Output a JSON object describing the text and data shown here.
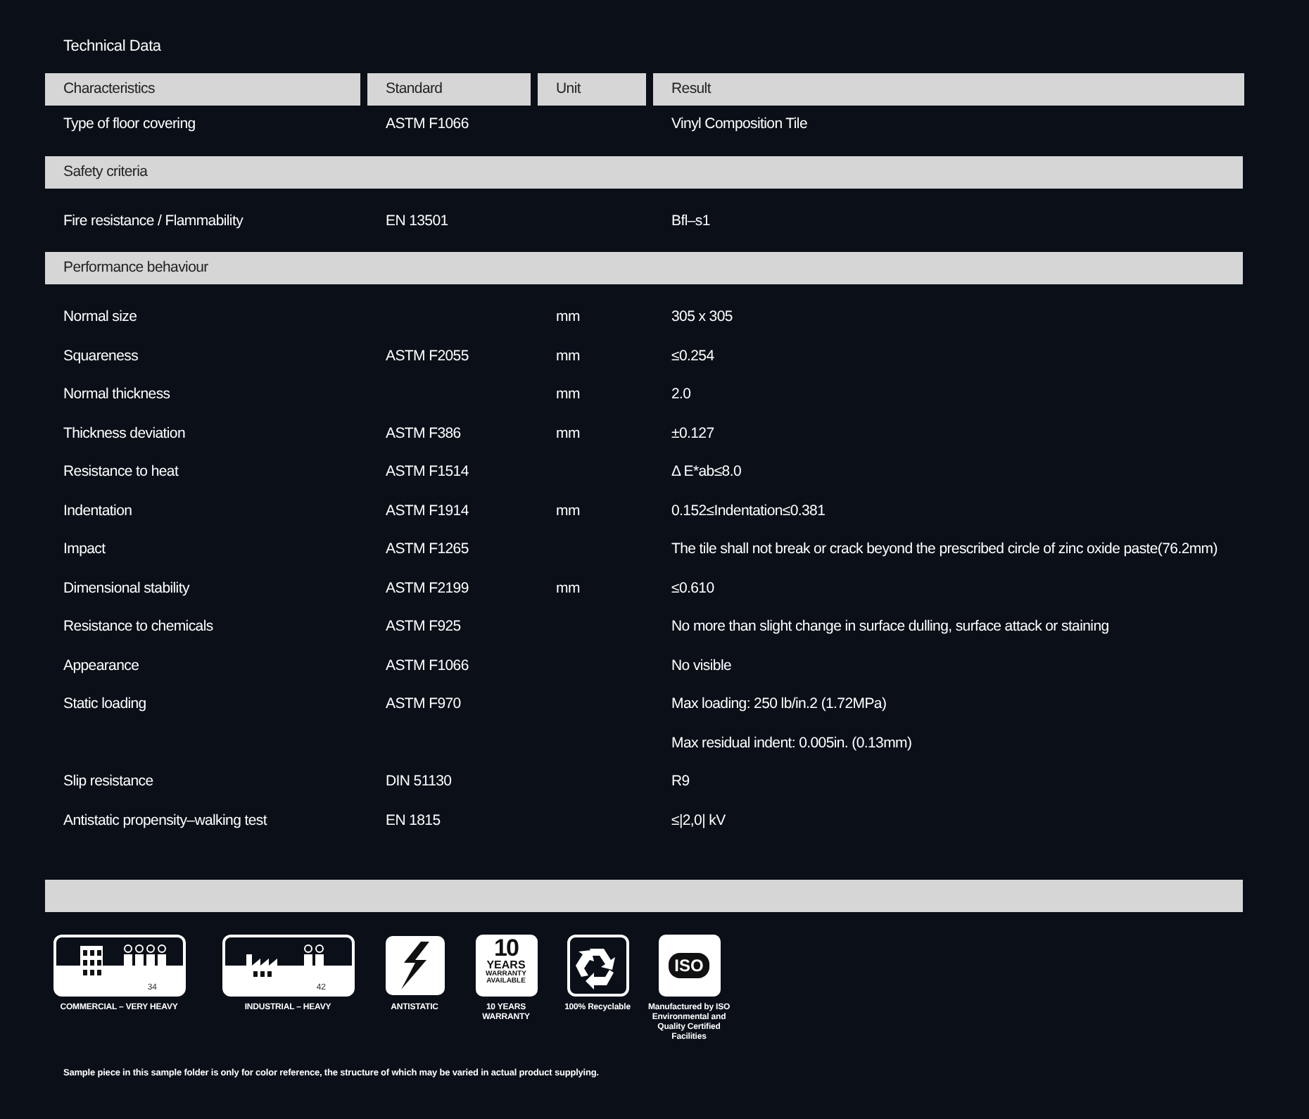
{
  "title": "Technical Data",
  "columns": [
    "Characteristics",
    "Standard",
    "Unit",
    "Result"
  ],
  "rows": [
    {
      "kind": "data",
      "cells": [
        "Type of floor covering",
        "ASTM F1066",
        "",
        "Vinyl Composition Tile"
      ]
    },
    {
      "kind": "section",
      "label": "Safety criteria"
    },
    {
      "kind": "data",
      "cells": [
        "Fire resistance / Flammability",
        "EN 13501",
        "",
        "Bfl–s1"
      ]
    },
    {
      "kind": "section",
      "label": "Performance behaviour"
    },
    {
      "kind": "data",
      "cells": [
        "Normal size",
        "",
        "mm",
        "305 x 305"
      ]
    },
    {
      "kind": "data",
      "cells": [
        "Squareness",
        "ASTM F2055",
        "mm",
        "≤0.254"
      ]
    },
    {
      "kind": "data",
      "cells": [
        "Normal thickness",
        "",
        "mm",
        "2.0"
      ]
    },
    {
      "kind": "data",
      "cells": [
        "Thickness deviation",
        "ASTM F386",
        "mm",
        "±0.127"
      ]
    },
    {
      "kind": "data",
      "cells": [
        "Resistance to heat",
        "ASTM F1514",
        "",
        "Δ E*ab≤8.0"
      ]
    },
    {
      "kind": "data",
      "cells": [
        "Indentation",
        "ASTM F1914",
        "mm",
        "0.152≤Indentation≤0.381"
      ]
    },
    {
      "kind": "data",
      "cells": [
        "Impact",
        "ASTM F1265",
        "",
        "The tile shall not break or crack beyond the prescribed circle of zinc oxide paste(76.2mm)"
      ]
    },
    {
      "kind": "data",
      "cells": [
        "Dimensional stability",
        "ASTM F2199",
        "mm",
        "≤0.610"
      ]
    },
    {
      "kind": "data",
      "cells": [
        "Resistance to chemicals",
        "ASTM F925",
        "",
        "No more than slight change in surface dulling, surface attack or staining"
      ]
    },
    {
      "kind": "data",
      "cells": [
        "Appearance",
        "ASTM F1066",
        "",
        "No visible"
      ]
    },
    {
      "kind": "data",
      "cells": [
        "Static loading",
        "ASTM F970",
        "",
        "Max loading: 250 lb/in.2 (1.72MPa)"
      ]
    },
    {
      "kind": "data",
      "cells": [
        "",
        "",
        "",
        "Max residual indent: 0.005in. (0.13mm)"
      ]
    },
    {
      "kind": "data",
      "cells": [
        "Slip resistance",
        "DIN 51130",
        "",
        "R9"
      ]
    },
    {
      "kind": "data",
      "cells": [
        "Antistatic propensity–walking test",
        "EN 1815",
        "",
        "≤|2,0| kV"
      ]
    }
  ],
  "badges": [
    {
      "kind": "commercial",
      "caption": "COMMERCIAL – VERY HEAVY",
      "code": "34"
    },
    {
      "kind": "industrial",
      "caption": "INDUSTRIAL – HEAVY",
      "code": "42"
    },
    {
      "kind": "antistatic",
      "caption": "ANTISTATIC"
    },
    {
      "kind": "warranty",
      "caption": "10 YEARS WARRANTY",
      "icon_lines": [
        "10",
        "YEARS",
        "WARRANTY",
        "AVAILABLE"
      ]
    },
    {
      "kind": "recycle",
      "caption": "100% Recyclable"
    },
    {
      "kind": "iso",
      "caption": "Manufactured by ISO Environmental and Quality Certified Facilities",
      "icon_text": "ISO"
    }
  ],
  "footnote": "Sample piece in this sample folder is only for color reference, the structure of which may be varied in actual product supplying."
}
